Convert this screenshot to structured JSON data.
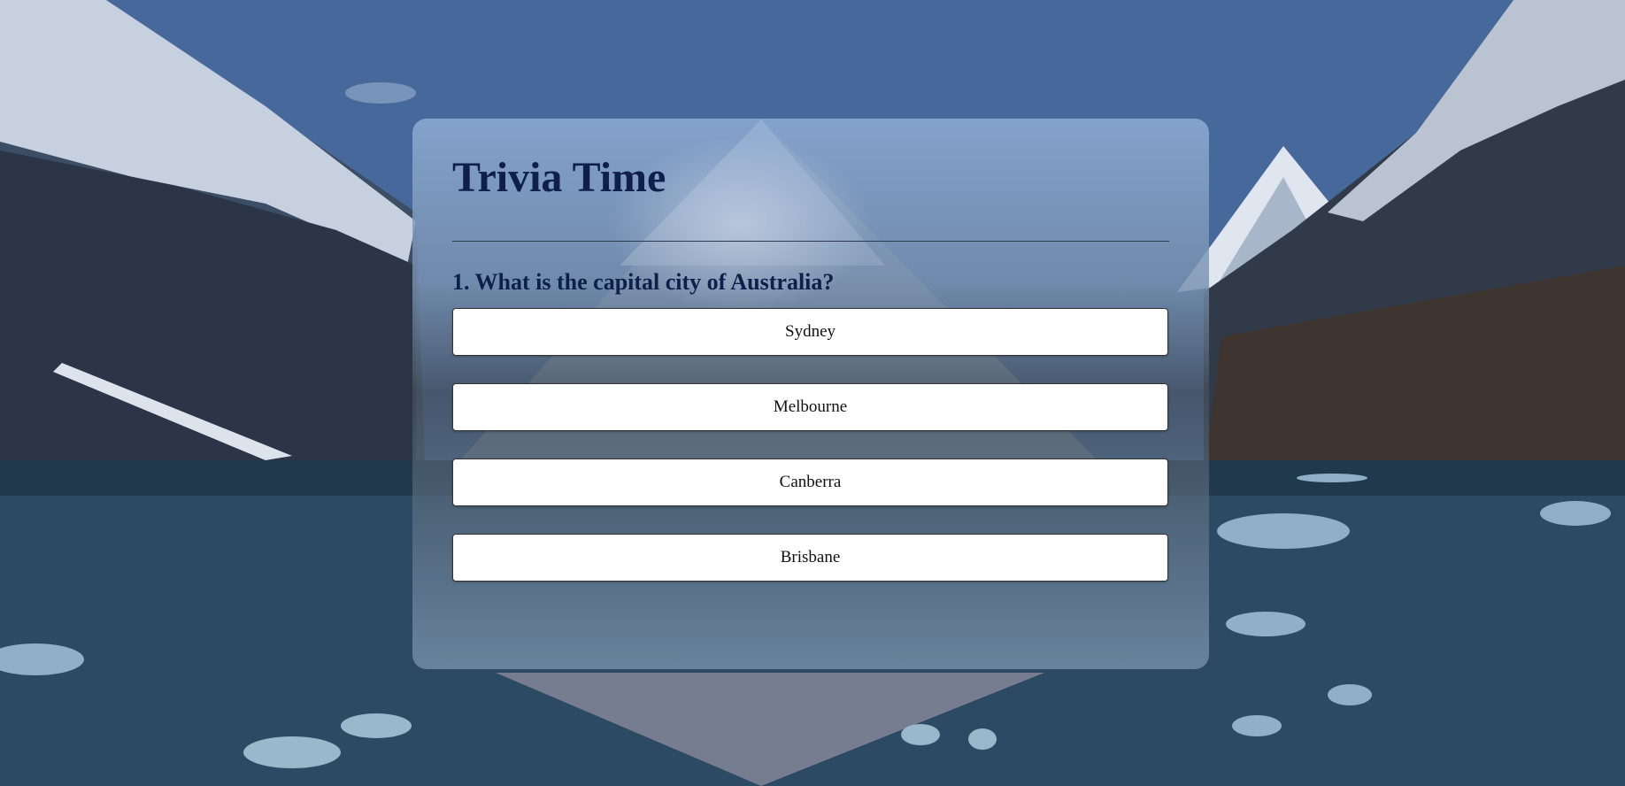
{
  "app": {
    "title": "Trivia Time"
  },
  "quiz": {
    "question": "1. What is the capital city of Australia?",
    "options": [
      {
        "label": "Sydney"
      },
      {
        "label": "Melbourne"
      },
      {
        "label": "Canberra"
      },
      {
        "label": "Brisbane"
      }
    ]
  },
  "colors": {
    "title_text": "#0d1f4a",
    "option_bg": "#ffffff",
    "card_overlay": "rgba(130,155,190,0.8)"
  }
}
